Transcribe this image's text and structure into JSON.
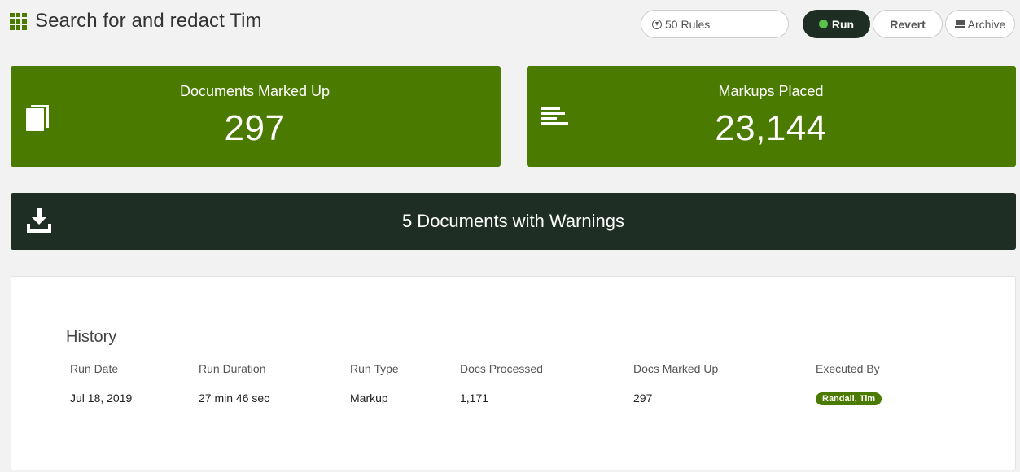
{
  "header": {
    "title": "Search for and redact Tim",
    "title_icon": "grid-icon"
  },
  "toolbar": {
    "rules_label": "50 Rules",
    "rules_icon": "arrow-circle-down-icon",
    "run_label": "Run",
    "revert_label": "Revert",
    "archive_label": "Archive",
    "archive_icon": "archive-icon"
  },
  "stats": {
    "documents": {
      "label": "Documents Marked Up",
      "value": "297",
      "icon": "document-icon"
    },
    "markups": {
      "label": "Markups Placed",
      "value": "23,144",
      "icon": "align-left-icon"
    }
  },
  "warnings": {
    "label": "5 Documents with Warnings",
    "icon": "download-icon"
  },
  "history": {
    "title": "History",
    "columns": [
      "Run Date",
      "Run Duration",
      "Run Type",
      "Docs Processed",
      "Docs Marked Up",
      "Executed By"
    ],
    "rows": [
      {
        "run_date": "Jul 18, 2019",
        "run_duration": "27 min 46 sec",
        "run_type": "Markup",
        "docs_processed": "1,171",
        "docs_marked_up": "297",
        "executed_by": "Randall, Tim"
      }
    ]
  },
  "colors": {
    "brand_green": "#4a7a00",
    "dark": "#1e2e24",
    "run_dot": "#5dc24a",
    "background": "#f2f2f2"
  }
}
